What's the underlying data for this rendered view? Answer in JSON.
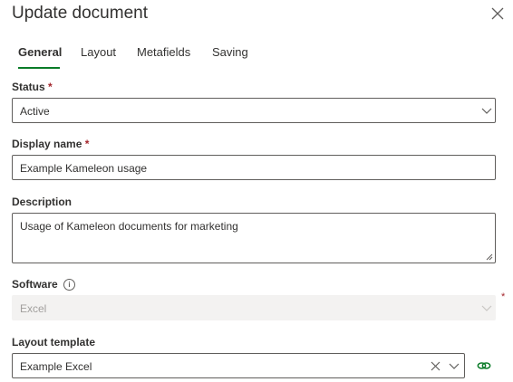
{
  "dialog": {
    "title": "Update document",
    "close_icon": "close-icon"
  },
  "tabs": [
    {
      "label": "General",
      "active": true
    },
    {
      "label": "Layout",
      "active": false
    },
    {
      "label": "Metafields",
      "active": false
    },
    {
      "label": "Saving",
      "active": false
    }
  ],
  "fields": {
    "status": {
      "label": "Status",
      "required": "*",
      "value": "Active"
    },
    "display_name": {
      "label": "Display name",
      "required": "*",
      "value": "Example Kameleon usage"
    },
    "description": {
      "label": "Description",
      "value": "Usage of Kameleon documents for marketing"
    },
    "software": {
      "label": "Software",
      "info_icon": "i",
      "required": "*",
      "value": "Excel",
      "disabled": true
    },
    "layout_template": {
      "label": "Layout template",
      "value": "Example Excel",
      "clear_icon": "clear-icon",
      "link_icon": "link-icon"
    }
  },
  "colors": {
    "accent": "#0a7b28",
    "required": "#a4262c",
    "border": "#605e5c",
    "disabled_bg": "#f3f2f1"
  }
}
